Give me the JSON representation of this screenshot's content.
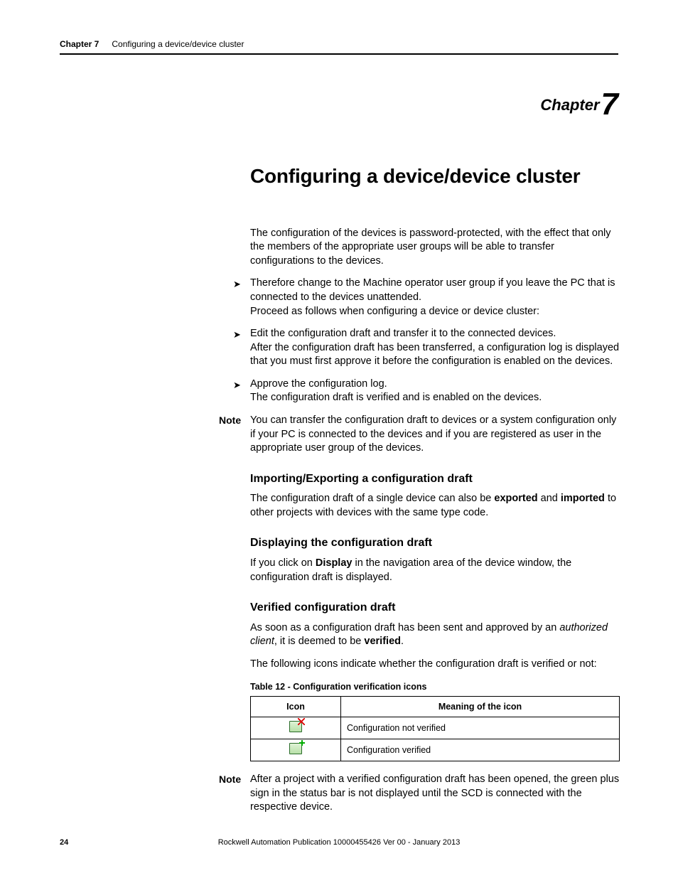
{
  "running_head": {
    "chapter_label": "Chapter 7",
    "title": "Configuring a device/device cluster"
  },
  "chapter_mark": {
    "word": "Chapter",
    "number": "7"
  },
  "title": "Configuring a device/device cluster",
  "intro_para": "The configuration of the devices is password-protected, with the effect that only the members of the appropriate user groups will be able to transfer configurations to the devices.",
  "bullet1": {
    "line1": "Therefore change to the Machine operator user group if you leave the PC that is connected to the devices unattended.",
    "line2": "Proceed as follows when configuring a device or device cluster:"
  },
  "bullet2": {
    "line1": "Edit the configuration draft and transfer it to the connected devices.",
    "line2": "After the configuration draft has been transferred, a configuration log is displayed that you must first approve it before the configuration is enabled on the devices."
  },
  "bullet3": {
    "line1": "Approve the configuration log.",
    "line2": "The configuration draft is verified and is enabled on the devices."
  },
  "note1": {
    "label": "Note",
    "text": "You can transfer the configuration draft to devices or a system configuration only if your PC is connected to the devices and if you are registered as user in the appropriate user group of the devices."
  },
  "sec_import": {
    "heading": "Importing/Exporting a configuration draft",
    "p_pre": "The configuration draft of a single device can also be ",
    "p_b1": "exported",
    "p_mid": " and ",
    "p_b2": "imported",
    "p_post": " to other projects with devices with the same type code."
  },
  "sec_display": {
    "heading": "Displaying the configuration draft",
    "p_pre": "If you click on ",
    "p_b1": "Display",
    "p_post": " in the navigation area of the device window, the configuration draft is displayed."
  },
  "sec_verified": {
    "heading": "Verified configuration draft",
    "p1_pre": "As soon as a configuration draft has been sent and approved by an ",
    "p1_i": "authorized client",
    "p1_mid": ", it is deemed to be ",
    "p1_b": "verified",
    "p1_post": ".",
    "p2": "The following icons indicate whether the configuration draft is verified or not:"
  },
  "table": {
    "caption": "Table 12 - Configuration verification icons",
    "h_icon": "Icon",
    "h_meaning": "Meaning of the icon",
    "rows": [
      {
        "icon_name": "config-not-verified-icon",
        "meaning": "Configuration not verified"
      },
      {
        "icon_name": "config-verified-icon",
        "meaning": "Configuration verified"
      }
    ]
  },
  "note2": {
    "label": "Note",
    "text": "After a project with a verified configuration draft has been opened, the green plus sign in the status bar is not displayed until the SCD is connected with the respective device."
  },
  "footer": {
    "page": "24",
    "publication": "Rockwell Automation Publication 10000455426 Ver 00 - January 2013"
  }
}
